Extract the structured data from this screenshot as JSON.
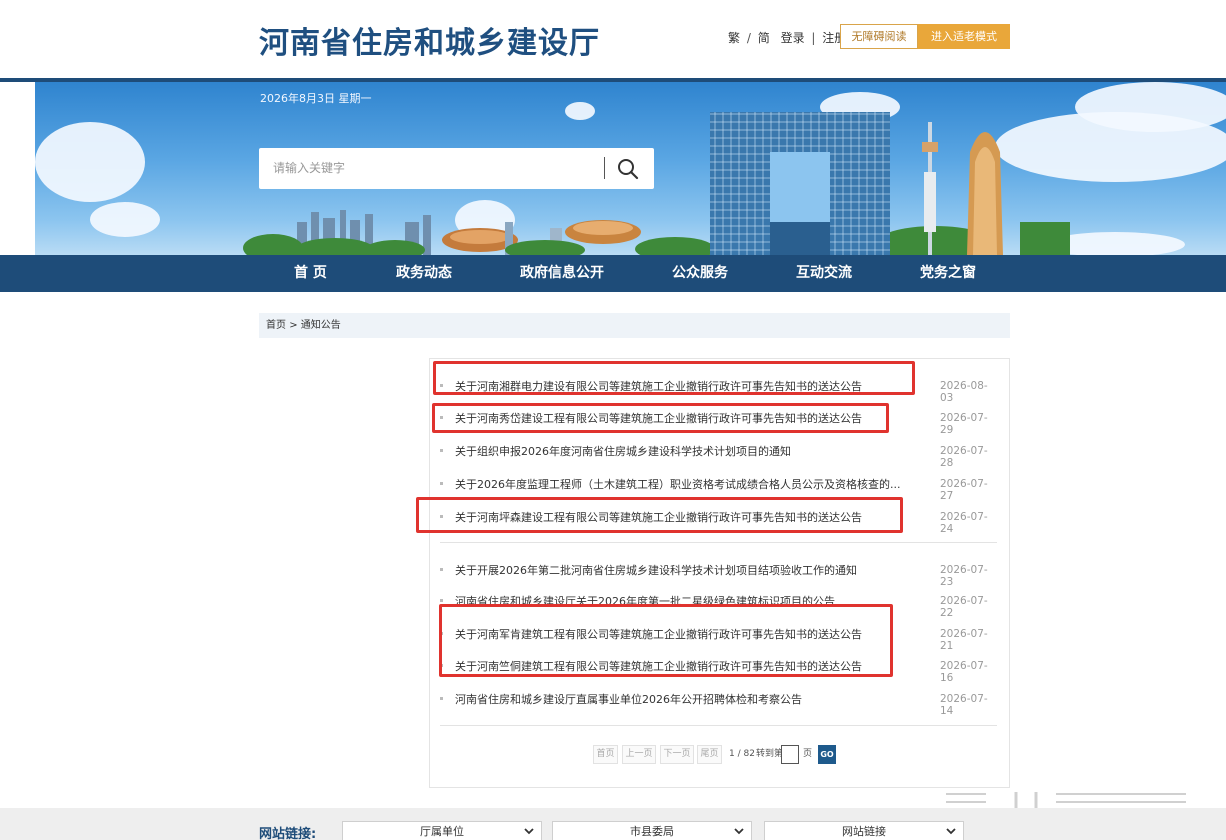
{
  "header": {
    "site_title": "河南省住房和城乡建设厅",
    "lang_trad": "繁",
    "lang_sep": "/",
    "lang_simp": "简",
    "login": "登录",
    "link_sep": "|",
    "register": "注册",
    "accessible_reading": "无障碍阅读",
    "elder_mode": "进入适老模式"
  },
  "banner": {
    "date": "2026年8月3日 星期一",
    "search_placeholder": "请输入关键字"
  },
  "nav": {
    "items": [
      "首 页",
      "政务动态",
      "政府信息公开",
      "公众服务",
      "互动交流",
      "党务之窗"
    ]
  },
  "breadcrumb": {
    "home": "首页",
    "sep": ">",
    "current": "通知公告"
  },
  "list": {
    "items": [
      {
        "title": "关于河南湘群电力建设有限公司等建筑施工企业撤销行政许可事先告知书的送达公告",
        "date": "2026-08-03"
      },
      {
        "title": "关于河南秀岱建设工程有限公司等建筑施工企业撤销行政许可事先告知书的送达公告",
        "date": "2026-07-29"
      },
      {
        "title": "关于组织申报2026年度河南省住房城乡建设科学技术计划项目的通知",
        "date": "2026-07-28"
      },
      {
        "title": "关于2026年度监理工程师（土木建筑工程）职业资格考试成绩合格人员公示及资格核查的...",
        "date": "2026-07-27"
      },
      {
        "title": "关于河南坪森建设工程有限公司等建筑施工企业撤销行政许可事先告知书的送达公告",
        "date": "2026-07-24"
      },
      {
        "title": "关于开展2026年第二批河南省住房城乡建设科学技术计划项目结项验收工作的通知",
        "date": "2026-07-23"
      },
      {
        "title": "河南省住房和城乡建设厅关于2026年度第一批二星级绿色建筑标识项目的公告",
        "date": "2026-07-22"
      },
      {
        "title": "关于河南军肯建筑工程有限公司等建筑施工企业撤销行政许可事先告知书的送达公告",
        "date": "2026-07-21"
      },
      {
        "title": "关于河南竺侗建筑工程有限公司等建筑施工企业撤销行政许可事先告知书的送达公告",
        "date": "2026-07-16"
      },
      {
        "title": "河南省住房和城乡建设厅直属事业单位2026年公开招聘体检和考察公告",
        "date": "2026-07-14"
      }
    ]
  },
  "pager": {
    "first": "首页",
    "prev": "上一页",
    "next": "下一页",
    "last": "尾页",
    "page_info": "1 / 82",
    "goto_label": "转到第",
    "page_unit": "页",
    "go": "GO"
  },
  "footer": {
    "label": "网站链接:",
    "selects": [
      "厅属单位",
      "市县委局",
      "网站链接"
    ]
  },
  "colors": {
    "primary": "#1e4c79",
    "highlight_red": "#e0332e",
    "elder_button": "#e9a73a"
  }
}
